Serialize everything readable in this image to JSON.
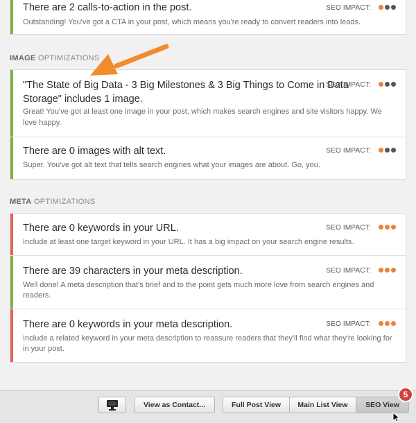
{
  "cta": {
    "title": "There are 2 calls-to-action in the post.",
    "desc": "Outstanding! You've got a CTA in your post, which means you're ready to convert readers into leads.",
    "impact_label": "SEO IMPACT:"
  },
  "image_section": {
    "bold": "IMAGE",
    "rest": " OPTIMIZATIONS"
  },
  "image_items": [
    {
      "title_line1": "\"The State of Big Data - 3 Big Milestones & 3 Big Things to Come in Data",
      "title_line2": "Storage\" includes 1 image.",
      "desc_line1": "Great! You've got at least one image in your post, which makes search engines and site visitors happy. We",
      "desc_line2": "love happy.",
      "impact_label": "SEO IMPACT:"
    },
    {
      "title": "There are 0 images with alt text.",
      "desc": "Super. You've got alt text that tells search engines what your images are about. Go, you.",
      "impact_label": "SEO IMPACT:"
    }
  ],
  "meta_section": {
    "bold": "META",
    "rest": " OPTIMIZATIONS"
  },
  "meta_items": [
    {
      "title": "There are 0 keywords in your URL.",
      "desc": "Include at least one target keyword in your URL. It has a big impact on your search engine results.",
      "impact_label": "SEO IMPACT:"
    },
    {
      "title": "There are 39 characters in your meta description.",
      "desc_line1": "Well done! A meta description that's brief and to the point gets much more love from search engines and",
      "desc_line2": "readers.",
      "impact_label": "SEO IMPACT:"
    },
    {
      "title": "There are 0 keywords in your meta description.",
      "desc_line1": "Include a related keyword in your meta description to reassure readers that they'll find what they're looking for",
      "desc_line2": "in your post.",
      "impact_label": "SEO IMPACT:"
    }
  ],
  "footer": {
    "view_as_contact": "View as Contact...",
    "full_post_view": "Full Post View",
    "main_list_view": "Main List View",
    "seo_view": "SEO View",
    "badge": "5"
  },
  "colors": {
    "pass": "#7cb342",
    "fail": "#e0655a",
    "impact_dot": "#e8823d",
    "arrow": "#f28a2e"
  }
}
